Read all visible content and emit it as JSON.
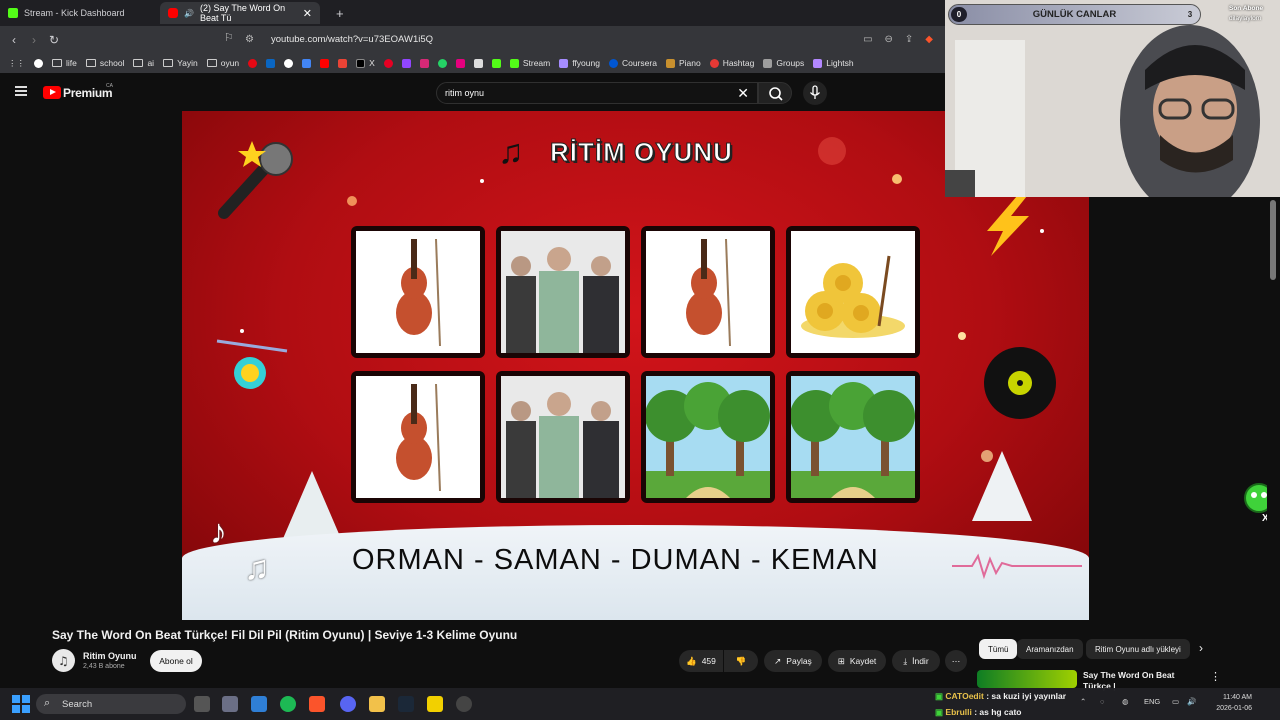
{
  "browser": {
    "tabs": [
      {
        "title": "Stream - Kick Dashboard",
        "icon": "kick-icon"
      },
      {
        "title": "(2) Say The Word On Beat Tü",
        "icon": "youtube-icon"
      }
    ],
    "url": "youtube.com/watch?v=u73EOAW1i5Q",
    "bookmarks": [
      "life",
      "school",
      "ai",
      "Yayin",
      "oyun",
      "X",
      "Stream",
      "ffyoung",
      "Coursera",
      "Piano",
      "Hashtag",
      "Groups",
      "Lightsh"
    ]
  },
  "youtube": {
    "logo_text": "Premium",
    "logo_sup": "CA",
    "search_value": "ritim oynu"
  },
  "video": {
    "title_overlay": "RİTİM OYUNU",
    "words": "ORMAN - SAMAN - DUMAN - KEMAN",
    "cards": [
      "violin",
      "band",
      "violin",
      "hay",
      "violin",
      "band",
      "forest",
      "forest"
    ]
  },
  "meta": {
    "title": "Say The Word On Beat Türkçe! Fil Dil Pil (Ritim Oyunu) | Seviye 1-3 Kelime Oyunu",
    "channel": "Ritim Oyunu",
    "subs": "2,43 B abone",
    "subscribe": "Abone ol",
    "likes": "459",
    "share": "Paylaş",
    "save": "Kaydet",
    "download": "İndir"
  },
  "chips": [
    "Tümü",
    "Aramanızdan",
    "Ritim Oyunu adlı yükleyi"
  ],
  "side_video": {
    "title": "Say The Word On Beat Türkçe |",
    "subtitle": "Ritim Uy ve Söyle | Seviye 1-3"
  },
  "stream": {
    "bar_label": "GÜNLÜK CANLAR",
    "bar_left": "0",
    "bar_right": "3",
    "last_sub_label": "Son Abone",
    "last_sub_name": "dilaylaylom",
    "chat": [
      {
        "user": "CATOedit",
        "msg": ": sa kuzi iyi yayınlar",
        "color": "#e8c14a"
      },
      {
        "user": "Ebrulli",
        "msg": ": as hg cato",
        "color": "#e8c14a"
      }
    ]
  },
  "taskbar": {
    "search": "Search",
    "lang": "ENG",
    "time": "11:40 AM",
    "date": "2026-01-06"
  }
}
